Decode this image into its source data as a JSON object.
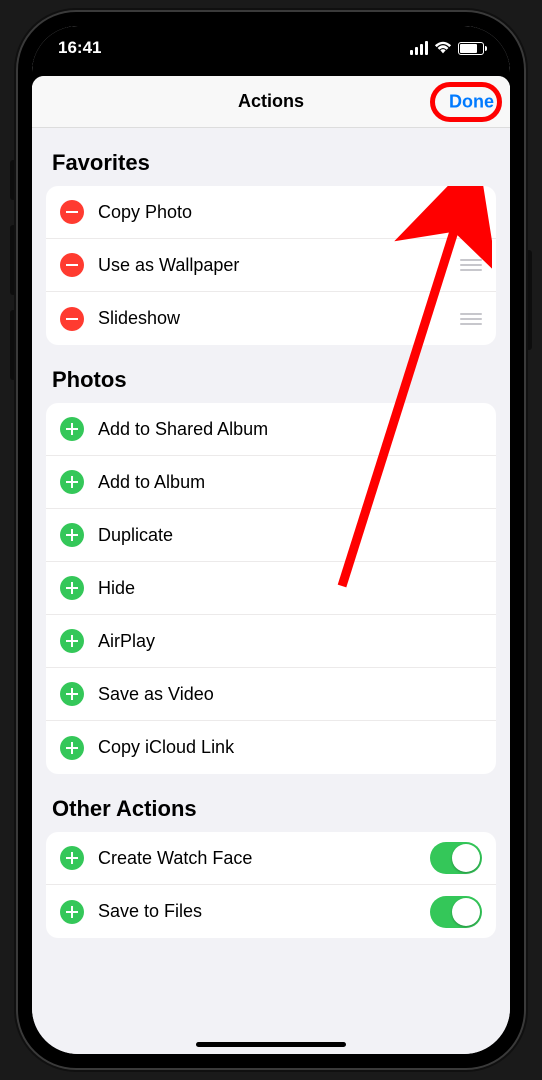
{
  "status": {
    "time": "16:41"
  },
  "nav": {
    "title": "Actions",
    "done_label": "Done"
  },
  "sections": {
    "favorites": {
      "title": "Favorites",
      "items": [
        {
          "label": "Copy Photo"
        },
        {
          "label": "Use as Wallpaper"
        },
        {
          "label": "Slideshow"
        }
      ]
    },
    "photos": {
      "title": "Photos",
      "items": [
        {
          "label": "Add to Shared Album"
        },
        {
          "label": "Add to Album"
        },
        {
          "label": "Duplicate"
        },
        {
          "label": "Hide"
        },
        {
          "label": "AirPlay"
        },
        {
          "label": "Save as Video"
        },
        {
          "label": "Copy iCloud Link"
        }
      ]
    },
    "other": {
      "title": "Other Actions",
      "items": [
        {
          "label": "Create Watch Face",
          "toggled": true
        },
        {
          "label": "Save to Files",
          "toggled": true
        }
      ]
    }
  },
  "colors": {
    "accent_blue": "#007aff",
    "destructive_red": "#ff3b30",
    "constructive_green": "#34c759",
    "annotation_red": "#ff0000"
  }
}
